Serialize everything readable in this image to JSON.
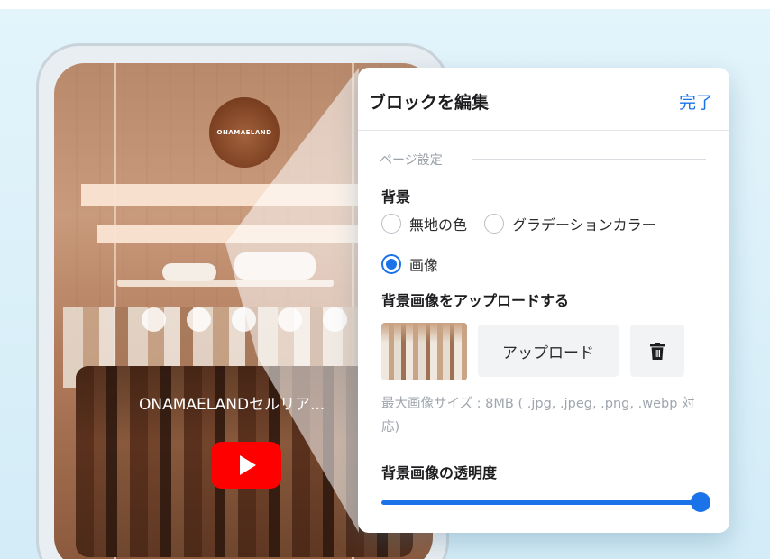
{
  "preview": {
    "logo_text": "ONAMAELAND",
    "video_title": "ONAMAELANDセルリア..."
  },
  "panel": {
    "title": "ブロックを編集",
    "done_label": "完了",
    "section_label": "ページ設定",
    "background_label": "背景",
    "background_options": [
      {
        "label": "無地の色",
        "selected": false
      },
      {
        "label": "グラデーションカラー",
        "selected": false
      },
      {
        "label": "画像",
        "selected": true
      }
    ],
    "upload_section_label": "背景画像をアップロードする",
    "upload_button_label": "アップロード",
    "upload_hint": "最大画像サイズ : 8MB ( .jpg, .jpeg, .png, .webp 対応)",
    "opacity_label": "背景画像の透明度",
    "opacity_value": 1.0
  },
  "colors": {
    "accent": "#1a73e8",
    "youtube_red": "#ff0000"
  }
}
